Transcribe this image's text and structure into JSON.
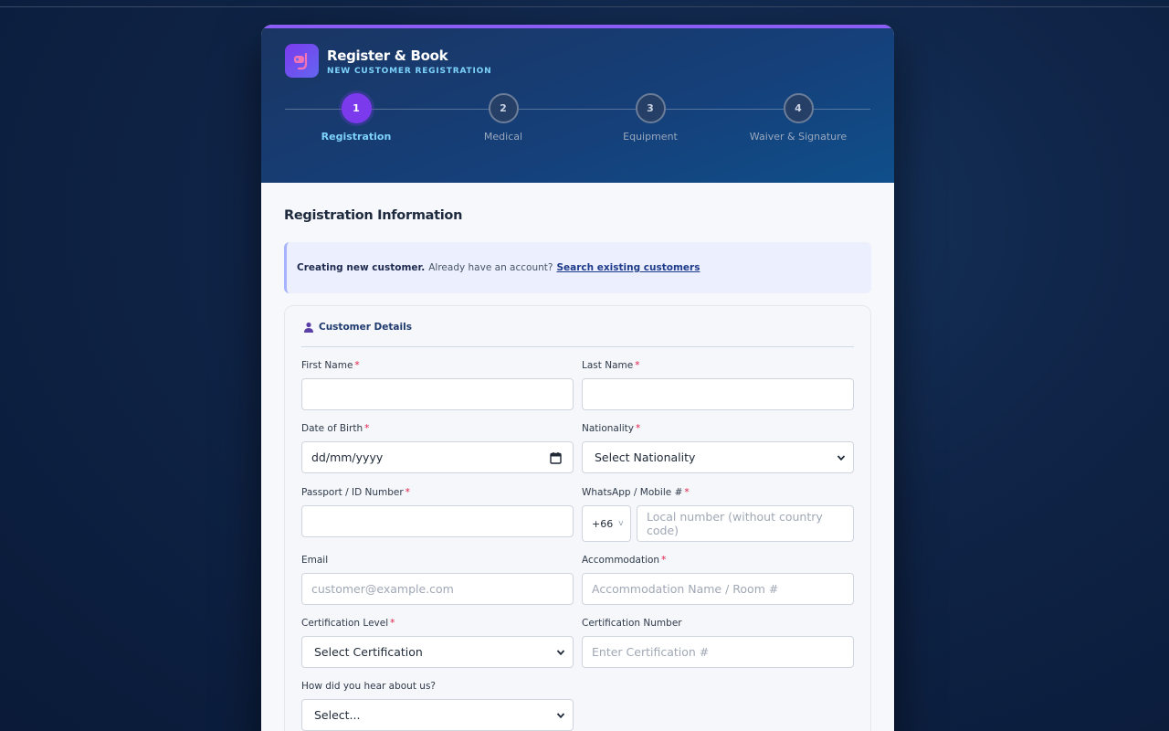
{
  "app": {
    "title": "Register & Book",
    "subtitle": "NEW CUSTOMER REGISTRATION"
  },
  "steps": [
    {
      "number": "1",
      "label": "Registration",
      "active": true
    },
    {
      "number": "2",
      "label": "Medical",
      "active": false
    },
    {
      "number": "3",
      "label": "Equipment",
      "active": false
    },
    {
      "number": "4",
      "label": "Waiver & Signature",
      "active": false
    }
  ],
  "section_title": "Registration Information",
  "notice": {
    "bold": "Creating new customer.",
    "text": "Already have an account?",
    "link": "Search existing customers"
  },
  "panel": {
    "title": "Customer Details",
    "required_marker": "*",
    "fields": {
      "first_name": {
        "label": "First Name"
      },
      "last_name": {
        "label": "Last Name"
      },
      "dob": {
        "label": "Date of Birth",
        "value": "dd/mm/yyyy"
      },
      "nationality": {
        "label": "Nationality",
        "value": "Select Nationality"
      },
      "passport": {
        "label": "Passport / ID Number"
      },
      "whatsapp": {
        "label": "WhatsApp / Mobile #",
        "code": "+66",
        "code_chevron": "v",
        "placeholder": "Local number (without country code)"
      },
      "email": {
        "label": "Email",
        "placeholder": "customer@example.com"
      },
      "accommodation": {
        "label": "Accommodation",
        "placeholder": "Accommodation Name / Room #"
      },
      "cert_level": {
        "label": "Certification Level",
        "value": "Select Certification"
      },
      "cert_number": {
        "label": "Certification Number",
        "placeholder": "Enter Certification #"
      },
      "hear_about": {
        "label": "How did you hear about us?",
        "value": "Select..."
      }
    }
  },
  "colors": {
    "accent": "#7c3aed",
    "step_active_label": "#7dd3fc",
    "required": "#e11d48"
  }
}
